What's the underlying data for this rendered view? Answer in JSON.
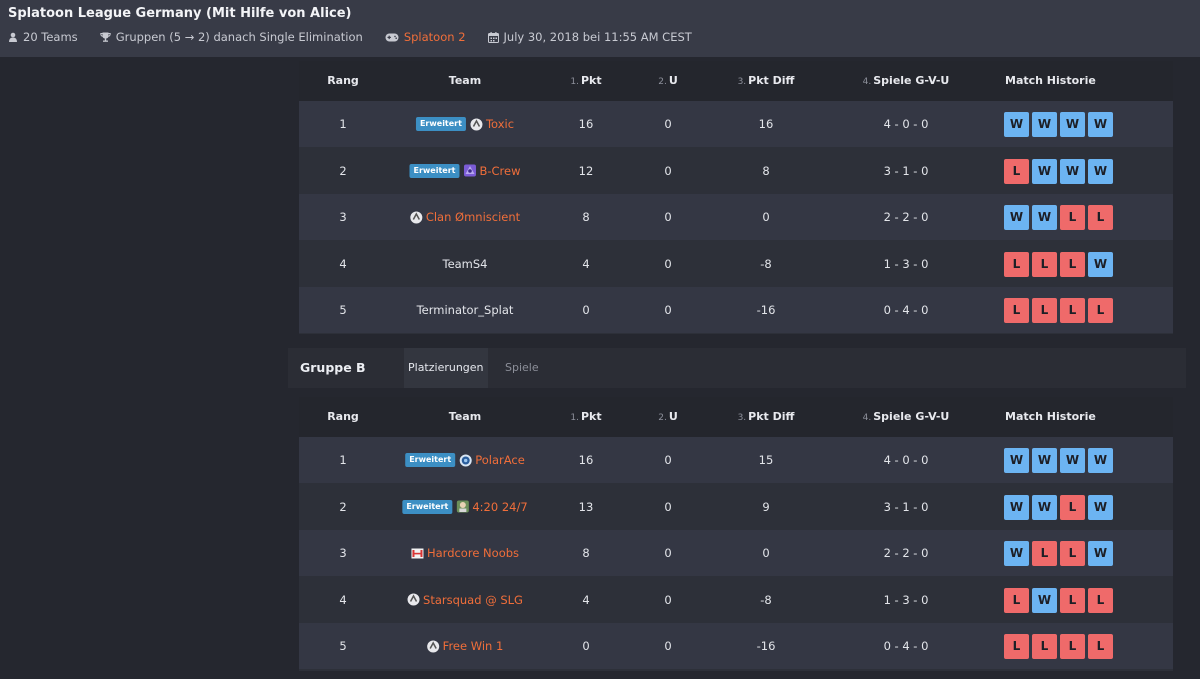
{
  "header": {
    "title": "Splatoon League Germany (Mit Hilfe von Alice)",
    "teams": "20 Teams",
    "format": "Gruppen (5 → 2) danach Single Elimination",
    "game": "Splatoon 2",
    "date": "July 30, 2018 bei 11:55 AM CEST"
  },
  "columns": {
    "rank": "Rang",
    "team": "Team",
    "pkt_num": "1.",
    "pkt": "Pkt",
    "u_num": "2.",
    "u": "U",
    "diff_num": "3.",
    "diff": "Pkt Diff",
    "games_num": "4.",
    "games": "Spiele G-V-U",
    "history": "Match Historie"
  },
  "group_b": {
    "name": "Gruppe B",
    "tab_standings": "Platzierungen",
    "tab_games": "Spiele"
  },
  "colors": {
    "accent": "#f06e3a",
    "win": "#6cb4f2",
    "loss": "#ef6a6a",
    "badge": "#3c8fc4"
  },
  "group_a_rows": [
    {
      "rank": "1",
      "badge": "Erweitert",
      "logo": "white-circle-logo",
      "team": "Toxic",
      "linked": true,
      "pkt": "16",
      "u": "0",
      "diff": "16",
      "games": "4 - 0 - 0",
      "history": [
        "W",
        "W",
        "W",
        "W"
      ]
    },
    {
      "rank": "2",
      "badge": "Erweitert",
      "logo": "purple-crest-logo",
      "team": "B-Crew",
      "linked": true,
      "pkt": "12",
      "u": "0",
      "diff": "8",
      "games": "3 - 1 - 0",
      "history": [
        "L",
        "W",
        "W",
        "W"
      ]
    },
    {
      "rank": "3",
      "badge": "",
      "logo": "white-circle-logo",
      "team": "Clan Ømniscient",
      "linked": true,
      "pkt": "8",
      "u": "0",
      "diff": "0",
      "games": "2 - 2 - 0",
      "history": [
        "W",
        "W",
        "L",
        "L"
      ]
    },
    {
      "rank": "4",
      "badge": "",
      "logo": "",
      "team": "TeamS4",
      "linked": false,
      "pkt": "4",
      "u": "0",
      "diff": "-8",
      "games": "1 - 3 - 0",
      "history": [
        "L",
        "L",
        "L",
        "W"
      ]
    },
    {
      "rank": "5",
      "badge": "",
      "logo": "",
      "team": "Terminator_Splat",
      "linked": false,
      "pkt": "0",
      "u": "0",
      "diff": "-16",
      "games": "0 - 4 - 0",
      "history": [
        "L",
        "L",
        "L",
        "L"
      ]
    }
  ],
  "group_b_rows": [
    {
      "rank": "1",
      "badge": "Erweitert",
      "logo": "blue-circle-logo",
      "team": "PolarAce",
      "linked": true,
      "pkt": "16",
      "u": "0",
      "diff": "15",
      "games": "4 - 0 - 0",
      "history": [
        "W",
        "W",
        "W",
        "W"
      ]
    },
    {
      "rank": "2",
      "badge": "Erweitert",
      "logo": "green-character-logo",
      "team": "4:20 24/7",
      "linked": true,
      "pkt": "13",
      "u": "0",
      "diff": "9",
      "games": "3 - 1 - 0",
      "history": [
        "W",
        "W",
        "L",
        "W"
      ]
    },
    {
      "rank": "3",
      "badge": "",
      "logo": "red-hn-logo",
      "team": "Hardcore Noobs",
      "linked": true,
      "pkt": "8",
      "u": "0",
      "diff": "0",
      "games": "2 - 2 - 0",
      "history": [
        "W",
        "L",
        "L",
        "W"
      ]
    },
    {
      "rank": "4",
      "badge": "",
      "logo": "white-circle-logo",
      "team": "Starsquad @ SLG",
      "linked": true,
      "pkt": "4",
      "u": "0",
      "diff": "-8",
      "games": "1 - 3 - 0",
      "history": [
        "L",
        "W",
        "L",
        "L"
      ]
    },
    {
      "rank": "5",
      "badge": "",
      "logo": "white-circle-logo",
      "team": "Free Win 1",
      "linked": true,
      "pkt": "0",
      "u": "0",
      "diff": "-16",
      "games": "0 - 4 - 0",
      "history": [
        "L",
        "L",
        "L",
        "L"
      ]
    }
  ]
}
